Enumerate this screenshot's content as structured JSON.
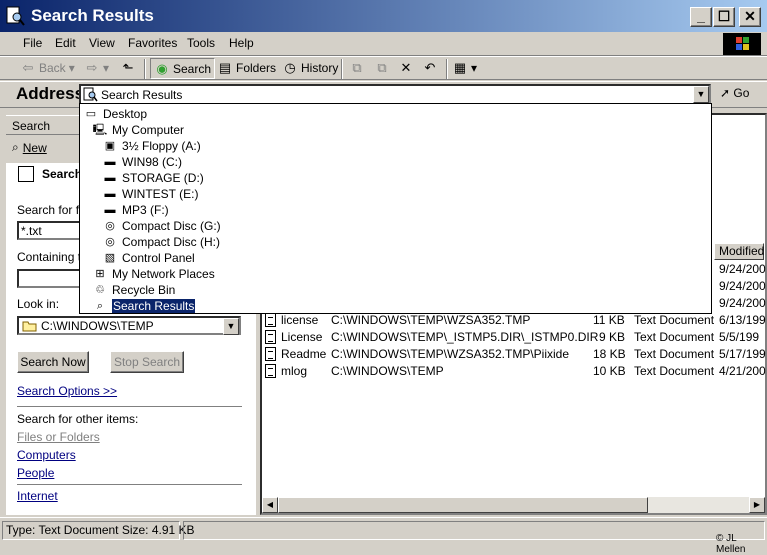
{
  "window": {
    "title": "Search Results",
    "min": "_",
    "max": "☐",
    "close": "✕"
  },
  "menu": [
    "File",
    "Edit",
    "View",
    "Favorites",
    "Tools",
    "Help"
  ],
  "toolbar": {
    "back": "Back",
    "search": "Search",
    "folders": "Folders",
    "history": "History"
  },
  "address": {
    "label": "Address",
    "value": "Search Results",
    "go": "Go"
  },
  "dropdown": [
    {
      "label": "Desktop",
      "icon": "desktop-icon",
      "level": 0
    },
    {
      "label": "My Computer",
      "icon": "computer-icon",
      "level": 1
    },
    {
      "label": "3½ Floppy (A:)",
      "icon": "floppy-icon",
      "level": 2
    },
    {
      "label": "WIN98 (C:)",
      "icon": "drive-icon",
      "level": 2
    },
    {
      "label": "STORAGE (D:)",
      "icon": "drive-icon",
      "level": 2
    },
    {
      "label": "WINTEST (E:)",
      "icon": "drive-icon",
      "level": 2
    },
    {
      "label": "MP3 (F:)",
      "icon": "drive-icon",
      "level": 2
    },
    {
      "label": "Compact Disc (G:)",
      "icon": "cd-icon",
      "level": 2
    },
    {
      "label": "Compact Disc (H:)",
      "icon": "cd-icon",
      "level": 2
    },
    {
      "label": "Control Panel",
      "icon": "control-panel-icon",
      "level": 2
    },
    {
      "label": "My Network Places",
      "icon": "network-icon",
      "level": 1
    },
    {
      "label": "Recycle Bin",
      "icon": "recycle-bin-icon",
      "level": 1
    },
    {
      "label": "Search Results",
      "icon": "search-results-icon",
      "level": 1,
      "selected": true
    }
  ],
  "search_pane": {
    "header": "Search",
    "new_label": "New",
    "section_title": "Search",
    "search_for_label": "Search for file",
    "search_for_value": "*.txt",
    "containing_label": "Containing te",
    "containing_value": "",
    "look_in_label": "Look in:",
    "look_in_value": "C:\\WINDOWS\\TEMP",
    "search_now": "Search Now",
    "stop_search": "Stop Search",
    "options": "Search Options >>",
    "other_items_label": "Search for other items:",
    "other_items": [
      "Files or Folders",
      "Computers",
      "People"
    ],
    "internet": "Internet"
  },
  "results": {
    "modified_header": "Modified",
    "rows": [
      {
        "name": "",
        "folder": "",
        "size": "",
        "type": "",
        "modified": "9/24/200"
      },
      {
        "name": "",
        "folder": "",
        "size": "",
        "type": "",
        "modified": "9/24/200"
      },
      {
        "name": "",
        "folder": "",
        "size": "",
        "type": "",
        "modified": "9/24/200"
      },
      {
        "name": "license",
        "folder": "C:\\WINDOWS\\TEMP\\WZSA352.TMP",
        "size": "11 KB",
        "type": "Text Document",
        "modified": "6/13/199"
      },
      {
        "name": "License",
        "folder": "C:\\WINDOWS\\TEMP\\_ISTMP5.DIR\\_ISTMP0.DIR",
        "size": "9 KB",
        "type": "Text Document",
        "modified": "5/5/199"
      },
      {
        "name": "Readme",
        "folder": "C:\\WINDOWS\\TEMP\\WZSA352.TMP\\Piixide",
        "size": "18 KB",
        "type": "Text Document",
        "modified": "5/17/199"
      },
      {
        "name": "mlog",
        "folder": "C:\\WINDOWS\\TEMP",
        "size": "10 KB",
        "type": "Text Document",
        "modified": "4/21/200"
      }
    ]
  },
  "status": {
    "text": "Type: Text Document Size: 4.91 KB"
  },
  "credit": "© JL Mellen"
}
